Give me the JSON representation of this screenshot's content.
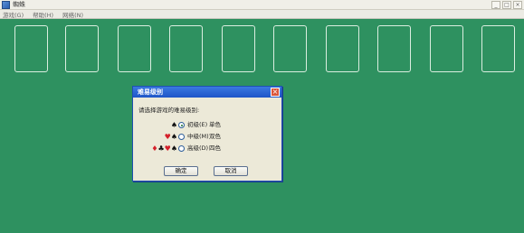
{
  "window": {
    "title": "蜘蛛"
  },
  "titlebar": {
    "close_glyph": "×"
  },
  "menu": {
    "items": [
      "游戏(G)",
      "帮助(H)",
      "网络(N)"
    ]
  },
  "dialog": {
    "title": "难易级别",
    "prompt": "请选择游戏的难易级别:",
    "options": [
      {
        "label": "初级(E)",
        "desc": "单色",
        "suits": [
          "♠"
        ],
        "checked": true
      },
      {
        "label": "中级(M)",
        "desc": "双色",
        "suits": [
          "♥",
          "♠"
        ],
        "checked": false
      },
      {
        "label": "高级(D)",
        "desc": "四色",
        "suits": [
          "♦",
          "♣",
          "♥",
          "♠"
        ],
        "checked": false
      }
    ],
    "ok_label": "确定",
    "cancel_label": "取消",
    "close_glyph": "×"
  }
}
